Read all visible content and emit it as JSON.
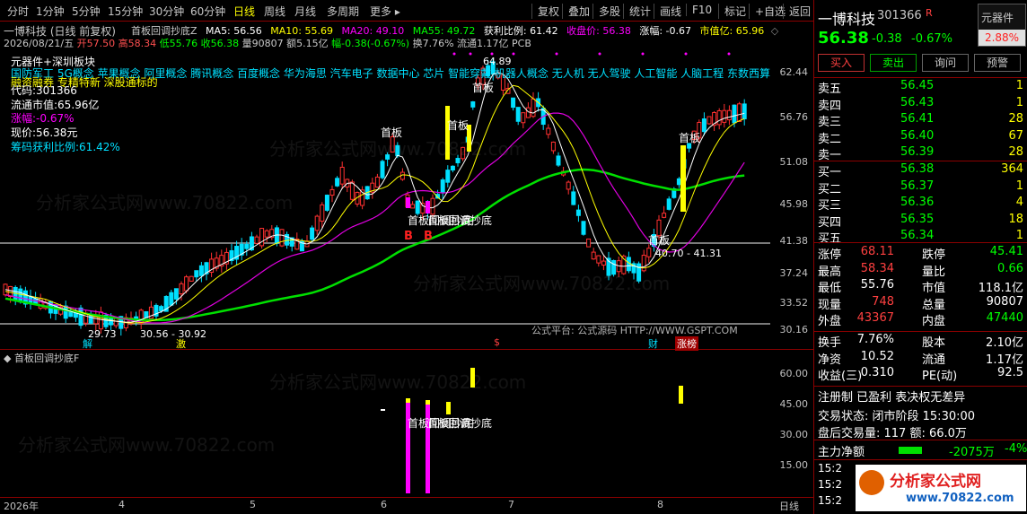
{
  "toolbar": {
    "periods": [
      "分时",
      "1分钟",
      "5分钟",
      "15分钟",
      "30分钟",
      "60分钟",
      "日线",
      "周线",
      "月线",
      "多周期",
      "更多 ▸"
    ],
    "active_period": "日线",
    "buttons": [
      "复权",
      "叠加",
      "多股",
      "统计",
      "画线",
      "F10",
      "标记",
      "+自选",
      "返回"
    ]
  },
  "chart_header": {
    "title": "一博科技 (日线 前复权)",
    "formula": "首板回调抄底Z",
    "ma5": "MA5: 56.56",
    "ma10": "MA10: 55.69",
    "ma20": "MA20: 49.10",
    "ma55": "MA55: 49.72",
    "profit_ratio": "获利比例: 61.42",
    "close_price": "收盘价: 56.38",
    "change_label": "涨幅: -0.67",
    "mktcap_label": "市值亿: 65.96",
    "ohlc": "2026/08/21/五",
    "open": "开57.50",
    "high": "高58.34",
    "low": "低55.76",
    "close": "收56.38",
    "vol": "量90807",
    "amount": "额5.15亿",
    "pct": "幅-0.38(-0.67%)",
    "turnover": "换7.76%",
    "float": "流通1.17亿",
    "pcb": "PCB"
  },
  "info_box": {
    "line1": "元器件+深圳板块",
    "concepts": "国防军工 5G概念 苹果概念 阿里概念 腾讯概念 百度概念 华为海思 汽车电子 数据中心 芯片 智能穿戴 机器人概念 无人机 无人驾驶 人工智能 人脑工程 东数西算 P",
    "line3": "融资融券 专精特新 深股通标的",
    "code": "代码:301366",
    "float_cap": "流通市值:65.96亿",
    "change": "涨幅:-0.67%",
    "price": "现价:56.38元",
    "profit": "筹码获利比例:61.42%"
  },
  "y_axis_main": [
    "62.44",
    "56.76",
    "51.08",
    "45.98",
    "41.38",
    "37.24",
    "33.52",
    "30.16"
  ],
  "y_axis_sub": [
    "60.00",
    "45.00",
    "30.00",
    "15.00"
  ],
  "annotations": {
    "shouban": "首板",
    "high_mark": "64.89",
    "low_mark1": "29.73",
    "low_mark2": "30.56 - 30.92",
    "range_mark": "40.70 - 41.31",
    "dip_text": "首板回调抄底",
    "buy": "B",
    "source": "公式平台: 公式源码 HTTP://WWW.GSPT.COM"
  },
  "sub_title": "首板回调抄底F",
  "x_axis": {
    "labels": [
      "2026年",
      "4",
      "5",
      "6",
      "7",
      "8"
    ],
    "tags": [
      "解",
      "激",
      "$",
      "财",
      "涨榜"
    ],
    "right": "日线"
  },
  "watermarks": [
    "分析家公式网www.70822.com"
  ],
  "quote": {
    "name": "一博科技",
    "code": "301366",
    "r_flag": "R",
    "sector": "元器件",
    "sector_pct": "2.88%",
    "price": "56.38",
    "chg": "-0.38",
    "pct": "-0.67%",
    "buttons": [
      "买入",
      "卖出",
      "询问",
      "预警"
    ],
    "asks": [
      {
        "label": "卖五",
        "price": "56.45",
        "vol": "1"
      },
      {
        "label": "卖四",
        "price": "56.43",
        "vol": "1"
      },
      {
        "label": "卖三",
        "price": "56.41",
        "vol": "28"
      },
      {
        "label": "卖二",
        "price": "56.40",
        "vol": "67"
      },
      {
        "label": "卖一",
        "price": "56.39",
        "vol": "28"
      }
    ],
    "bids": [
      {
        "label": "买一",
        "price": "56.38",
        "vol": "364"
      },
      {
        "label": "买二",
        "price": "56.37",
        "vol": "1"
      },
      {
        "label": "买三",
        "price": "56.36",
        "vol": "4"
      },
      {
        "label": "买四",
        "price": "56.35",
        "vol": "18"
      },
      {
        "label": "买五",
        "price": "56.34",
        "vol": "1"
      }
    ],
    "stats": [
      {
        "l1": "涨停",
        "v1": "68.11",
        "l2": "跌停",
        "v2": "45.41"
      },
      {
        "l1": "最高",
        "v1": "58.34",
        "l2": "量比",
        "v2": "0.66"
      },
      {
        "l1": "最低",
        "v1": "55.76",
        "l2": "市值",
        "v2": "118.1亿"
      },
      {
        "l1": "现量",
        "v1": "748",
        "l2": "总量",
        "v2": "90807"
      },
      {
        "l1": "外盘",
        "v1": "43367",
        "l2": "内盘",
        "v2": "47440"
      }
    ],
    "fund": [
      {
        "l1": "换手",
        "v1": "7.76%",
        "l2": "股本",
        "v2": "2.10亿"
      },
      {
        "l1": "净资",
        "v1": "10.52",
        "l2": "流通",
        "v2": "1.17亿"
      },
      {
        "l1": "收益(三)",
        "v1": "0.310",
        "l2": "PE(动)",
        "v2": "92.5"
      }
    ],
    "reg": "注册制 已盈利 表决权无差异",
    "trade_state": "交易状态: 闭市阶段 15:30:00",
    "after_hours": "盘后交易量: 117  额: 66.0万",
    "mainforce_label": "主力净额",
    "mainforce_val": "-2075万",
    "mainforce_pct": "-4%",
    "ticks": [
      "15:2",
      "15:2",
      "15:2"
    ],
    "brand": "分析家公式网",
    "brand_url": "www.70822.com"
  }
}
